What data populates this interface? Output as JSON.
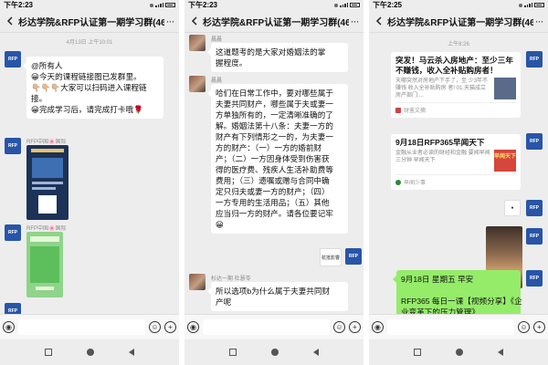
{
  "phones": [
    {
      "status_time": "下午2:23",
      "title": "杉达学院&RFP认证第一期学习群(46)",
      "timestamp": "4月13日 上午10:01",
      "rfp_label": "RFP中国",
      "msg1_lines": [
        "@所有人",
        "😀今天的课程链接图已发群里。",
        "👇🏼👇🏼👇🏼大家可以扫码进入课程链",
        "接。",
        "😀完成学习后，请完成打卡哦🌹"
      ],
      "sender2": "RFP中国🌸国际",
      "sender3": "RFP中国🌸国际"
    },
    {
      "status_time": "下午2:23",
      "title": "杉达学院&RFP认证第一期学习群(46)",
      "sender_a": "晨晨",
      "msg_a_lines": [
        "这道题考的是大家对婚姻法的掌",
        "握程度。"
      ],
      "sender_b": "晨晨",
      "msg_b_lines": [
        "哈们在日常工作中，要对哪些属于",
        "夫妻共同财产，哪些属于夫或妻一",
        "方单独所有的，一定清晰准确的了",
        "解。婚姻法第十八条：夫妻一方的",
        "财产有下列情形之一的，为夫妻一",
        "方的财产：（一）一方的婚前财",
        "产；（二）一方因身体受到伤害获",
        "得的医疗费、残疾人生活补助费等",
        "费用；（三）遗嘱或赠与合同中确",
        "定只归夫或妻一方的财产；（四）",
        "一方专用的生活用品；（五）其他",
        "应当归一方的财产。请各位要记牢",
        "😀"
      ],
      "logo_label": "杭抵影響",
      "sender_c": "杉达一期 杜慧苓",
      "msg_c_lines": [
        "所以选项b为什么属于夫妻共同财",
        "产呢"
      ]
    },
    {
      "status_time": "下午2:25",
      "title": "杉达学院&RFP认证第一期学习群(46)",
      "timestamp": "上午8:26",
      "card1_title": "突发！马云杀入房地产：至少三年不赚钱，收入全补贴购房者！",
      "card1_desc_lines": [
        "天哪突然对房地产下手了，至",
        "少3年不赚钱 收入全补贴购房",
        "者! 01.天猫成立房产部门:..."
      ],
      "card1_src": "财鉴文摘",
      "card2_title": "9月18日RFP365早闻天下",
      "card2_desc_lines": [
        "金融从业者必读的财经和金融",
        "要闻早闻三分钟 早闻天下"
      ],
      "card2_badge": "早闻天下",
      "card2_src": "早闻少事",
      "card3_lines": [
        "9月18日 星期五 早安",
        "",
        "RFP365 每日一课【视频分享】《企",
        "业变革下的压力管理》"
      ]
    }
  ],
  "icons": [
    "voice-icon",
    "emoji-icon",
    "plus-icon",
    "back-arrow-icon",
    "more-icon"
  ]
}
